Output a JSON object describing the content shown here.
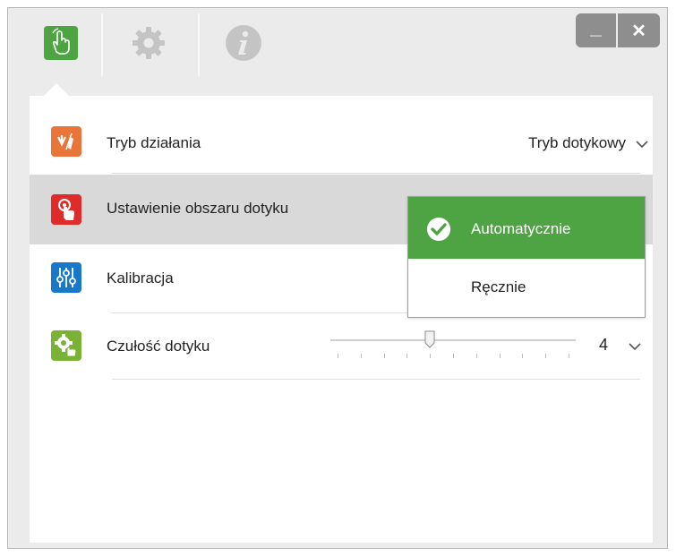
{
  "tabs": [
    {
      "name": "touch-hand-icon",
      "active": true,
      "color": "#4ea443"
    },
    {
      "name": "gear-icon",
      "active": false
    },
    {
      "name": "info-icon",
      "active": false
    }
  ],
  "window_buttons": {
    "minimize_glyph": "_",
    "close_glyph": "✕"
  },
  "rows": [
    {
      "label": "Tryb działania",
      "value": "Tryb dotykowy",
      "icon": "mode-icon",
      "icon_color": "#e8763a"
    },
    {
      "label": "Ustawienie obszaru dotyku",
      "icon": "touch-area-icon",
      "icon_color": "#e02b2b",
      "highlighted": true
    },
    {
      "label": "Kalibracja",
      "icon": "calibration-icon",
      "icon_color": "#1a78c9"
    },
    {
      "label": "Czułość dotyku",
      "value": "4",
      "icon": "sensitivity-icon",
      "icon_color": "#7ab236",
      "slider_level": 4,
      "slider_min": 0,
      "slider_max": 10
    }
  ],
  "dropdown": {
    "selected": "Automatycznie",
    "options": [
      "Automatycznie",
      "Ręcznie"
    ],
    "accent": "#4ea443"
  }
}
